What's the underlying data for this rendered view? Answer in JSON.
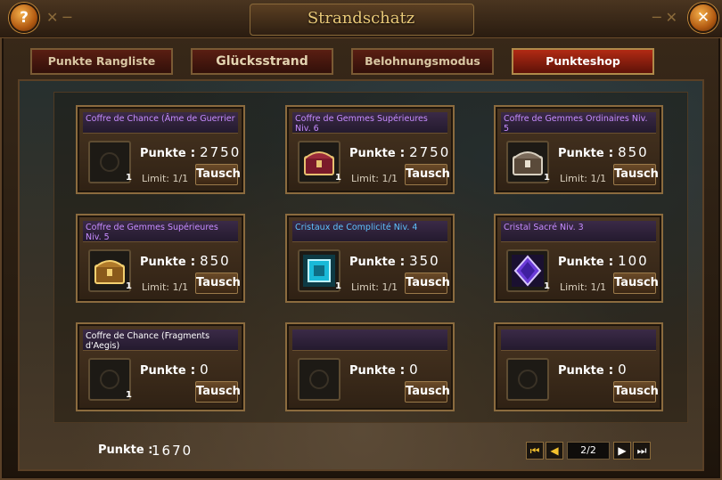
{
  "window": {
    "title": "Strandschatz"
  },
  "header": {
    "help_label": "?",
    "close_label": "✕"
  },
  "tabs": [
    {
      "label": "Punkte Rangliste",
      "active": false
    },
    {
      "label": "Glücksstrand",
      "active": false
    },
    {
      "label": "Belohnungsmodus",
      "active": false
    },
    {
      "label": "Punkteshop",
      "active": true
    }
  ],
  "shop": {
    "points_label": "Punkte",
    "limit_label": "Limit: 1/1",
    "button_label": "Tausch",
    "items": [
      {
        "title": "Coffre de Chance (Âme de Guerrier",
        "title_color": "purple",
        "points": "2750",
        "quantity": "1",
        "limit": "Limit: 1/1",
        "icon": "empty"
      },
      {
        "title": "Coffre de Gemmes Supérieures Niv. 6",
        "title_color": "purple",
        "points": "2750",
        "quantity": "1",
        "limit": "Limit: 1/1",
        "icon": "chest-red"
      },
      {
        "title": "Coffre de Gemmes Ordinaires Niv. 5",
        "title_color": "purple",
        "points": "850",
        "quantity": "1",
        "limit": "Limit: 1/1",
        "icon": "chest-silver"
      },
      {
        "title": "Coffre de Gemmes Supérieures Niv. 5",
        "title_color": "purple",
        "points": "850",
        "quantity": "1",
        "limit": "Limit: 1/1",
        "icon": "chest-gold"
      },
      {
        "title": "Cristaux de Complicité Niv. 4",
        "title_color": "blue",
        "points": "350",
        "quantity": "1",
        "limit": "Limit: 1/1",
        "icon": "crystal-cyan"
      },
      {
        "title": "Cristal Sacré Niv. 3",
        "title_color": "purple",
        "points": "100",
        "quantity": "1",
        "limit": "Limit: 1/1",
        "icon": "gem-purple"
      },
      {
        "title": "Coffre de Chance (Fragments d'Aegis)",
        "title_color": "white",
        "points": "0",
        "quantity": "1",
        "limit": "",
        "icon": "empty"
      },
      {
        "title": "",
        "title_color": "purple",
        "points": "0",
        "quantity": "",
        "limit": "",
        "icon": "empty"
      },
      {
        "title": "",
        "title_color": "purple",
        "points": "0",
        "quantity": "",
        "limit": "",
        "icon": "empty"
      }
    ]
  },
  "footer": {
    "total_label": "Punkte :",
    "total_value": "1670",
    "page": "2/2"
  },
  "colors": {
    "accent": "#e9c978",
    "tab_active": "#b22a14",
    "purple_text": "#c78cff",
    "blue_text": "#5ec2ff"
  }
}
